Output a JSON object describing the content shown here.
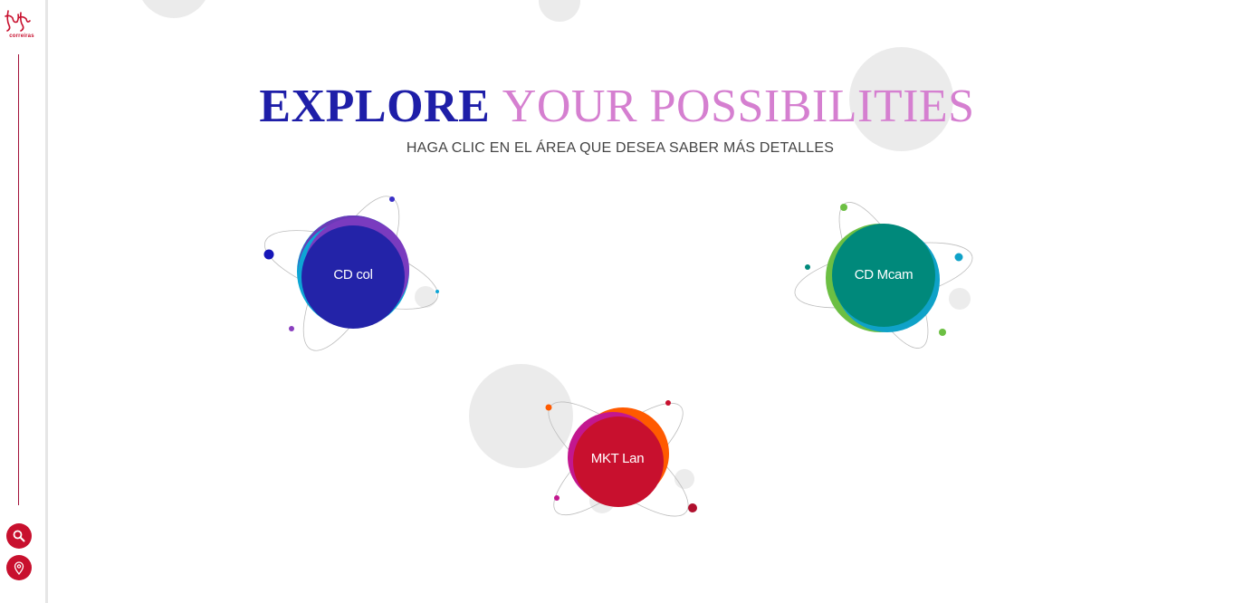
{
  "sidebar": {
    "logo_text": "correiras",
    "buttons": [
      {
        "icon": "search-icon"
      },
      {
        "icon": "location-pin-icon"
      }
    ]
  },
  "header": {
    "title_part1": "EXPLORE",
    "title_part2": "YOUR POSSIBILITIES",
    "subtitle": "HAGA CLIC EN EL ÁREA QUE DESEA SABER MÁS DETALLES"
  },
  "planets": [
    {
      "label": "CD col"
    },
    {
      "label": "CD Mcam"
    },
    {
      "label": "MKT Lan"
    }
  ],
  "colors": {
    "brand_red": "#c8102e",
    "title_blue": "#1e1ea8",
    "title_pink": "#d57fd0",
    "cd_col": "#2323a8",
    "cd_mcam": "#00897b",
    "mkt_lan": "#c8102e"
  }
}
